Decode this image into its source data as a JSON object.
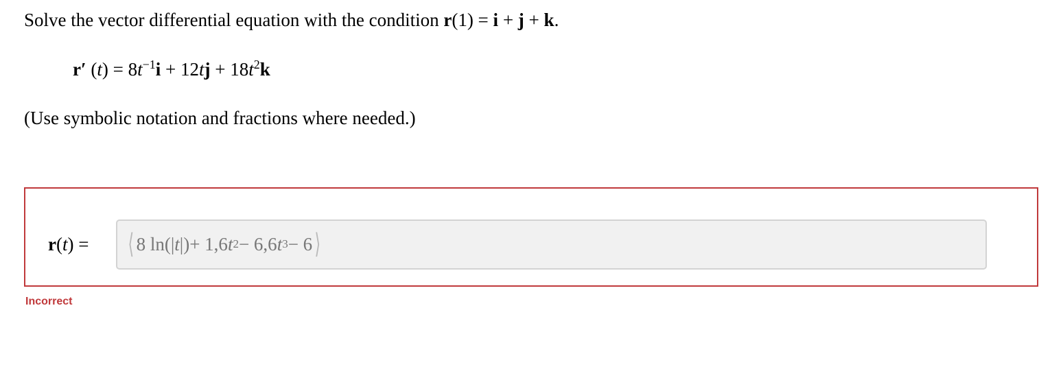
{
  "question": {
    "intro": "Solve the vector differential equation with the condition ",
    "condition_lhs": "r",
    "condition_arg": "(1) = ",
    "condition_rhs": [
      "i",
      " + ",
      "j",
      " + ",
      "k"
    ],
    "period": ".",
    "equation": {
      "lhs_vec": "r",
      "lhs_prime": "′",
      "lhs_arg_open": " (",
      "lhs_var": "t",
      "lhs_arg_close": ") = ",
      "term1_coef": "8",
      "term1_var": "t",
      "term1_exp": "−1",
      "term1_vec": "i",
      "plus1": " + ",
      "term2_coef": "12",
      "term2_var": "t",
      "term2_vec": "j",
      "plus2": " + ",
      "term3_coef": "18",
      "term3_var": "t",
      "term3_exp": "2",
      "term3_vec": "k"
    },
    "note": "(Use symbolic notation and fractions where needed.)"
  },
  "answer": {
    "lhs_vec": "r",
    "lhs_arg_open": "(",
    "lhs_var": "t",
    "lhs_arg_close": ") =",
    "field_value": {
      "p1": "8 ln",
      "abs_open": "(|",
      "abs_var": "t",
      "abs_close": "|)",
      "p2": " + 1,6",
      "var2": "t",
      "exp2": "2",
      "p3": " − 6,6",
      "var3": "t",
      "exp3": "3",
      "p4": " − 6"
    }
  },
  "feedback": "Incorrect",
  "colors": {
    "incorrect": "#c0393b",
    "field_bg": "#f1f1f1",
    "field_border": "#d3d3d3",
    "field_text": "#777777"
  }
}
